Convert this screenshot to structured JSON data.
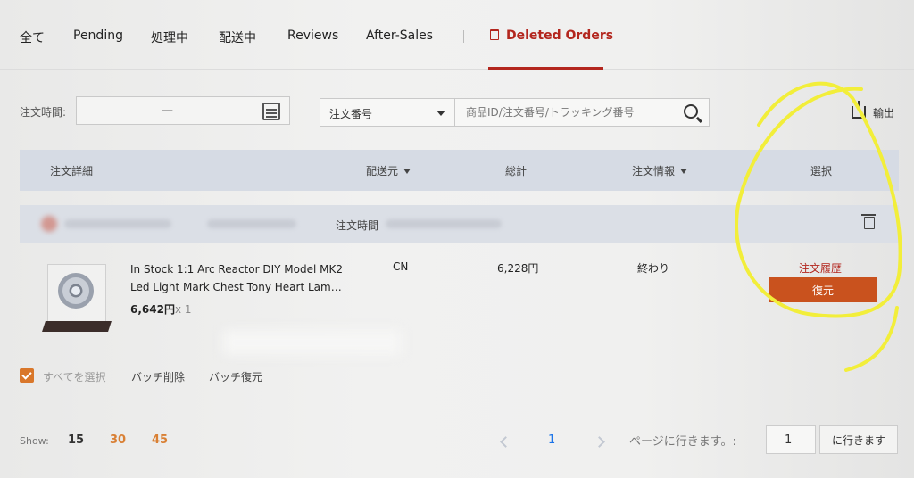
{
  "tabs": [
    {
      "label": "全て"
    },
    {
      "label": "Pending"
    },
    {
      "label": "処理中"
    },
    {
      "label": "配送中"
    },
    {
      "label": "Reviews"
    },
    {
      "label": "After-Sales"
    },
    {
      "label": "Deleted Orders",
      "active": true
    }
  ],
  "filters": {
    "order_time_label": "注文時間:",
    "date_separator": "—",
    "search_type": "注文番号",
    "search_placeholder": "商品ID/注文番号/トラッキング番号",
    "export_label": "輸出"
  },
  "table_header": {
    "details": "注文詳細",
    "ship_from": "配送元",
    "total": "総計",
    "order_info": "注文情報",
    "select": "選択"
  },
  "order": {
    "time_label": "注文時間",
    "title": "In Stock 1:1 Arc Reactor DIY Model MK2 Led Light Mark Chest Tony Heart Lam…",
    "price": "6,642円",
    "quantity": "x 1",
    "ship_from": "CN",
    "total": "6,228円",
    "status": "終わり",
    "history_link": "注文履歴",
    "restore_button": "復元"
  },
  "batch": {
    "select_all": "すべてを選択",
    "batch_delete": "バッチ削除",
    "batch_restore": "バッチ復元"
  },
  "pagination": {
    "show_label": "Show:",
    "sizes": [
      "15",
      "30",
      "45"
    ],
    "current_page": "1",
    "goto_label": "ページに行きます。:",
    "goto_value": "1",
    "goto_button": "に行きます"
  },
  "colors": {
    "accent_red": "#b3261e",
    "restore_orange": "#c9521e",
    "annotation_yellow": "#f2ee3a",
    "header_bg": "#d6dbe4"
  }
}
